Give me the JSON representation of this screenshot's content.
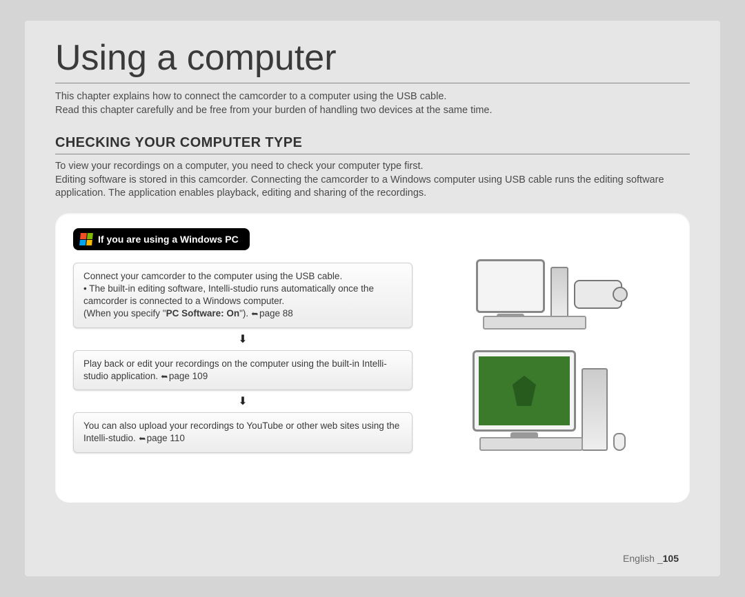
{
  "title": "Using a computer",
  "intro": {
    "line1": "This chapter explains how to connect the camcorder to a computer using the USB cable.",
    "line2": "Read this chapter carefully and be free from your burden of handling two devices at the same time."
  },
  "section_heading": "CHECKING YOUR COMPUTER TYPE",
  "section_desc": {
    "line1": "To view your recordings on a computer, you need to check your computer type first.",
    "line2": "Editing software is stored in this camcorder. Connecting the camcorder to a Windows computer using USB cable runs the editing software application. The application enables playback, editing and sharing of the recordings."
  },
  "badge_label": "If you are using a Windows PC",
  "steps": {
    "s1a": "Connect your camcorder to the computer using the USB cable.",
    "s1b_prefix": "• The built-in editing software, Intelli-studio runs automatically once the camcorder is connected to a Windows computer.",
    "s1c_prefix": "(When you specify \"",
    "s1c_bold": "PC Software: On",
    "s1c_suffix": "\"). ",
    "s1c_page": "page 88",
    "s2": "Play back or edit your recordings on the computer using the built-in Intelli-studio application. ",
    "s2_page": "page 109",
    "s3": "You can also upload your recordings to YouTube or other web sites using the Intelli-studio. ",
    "s3_page": "page 110"
  },
  "footer": {
    "lang": "English",
    "sep": " _",
    "page_number": "105"
  }
}
